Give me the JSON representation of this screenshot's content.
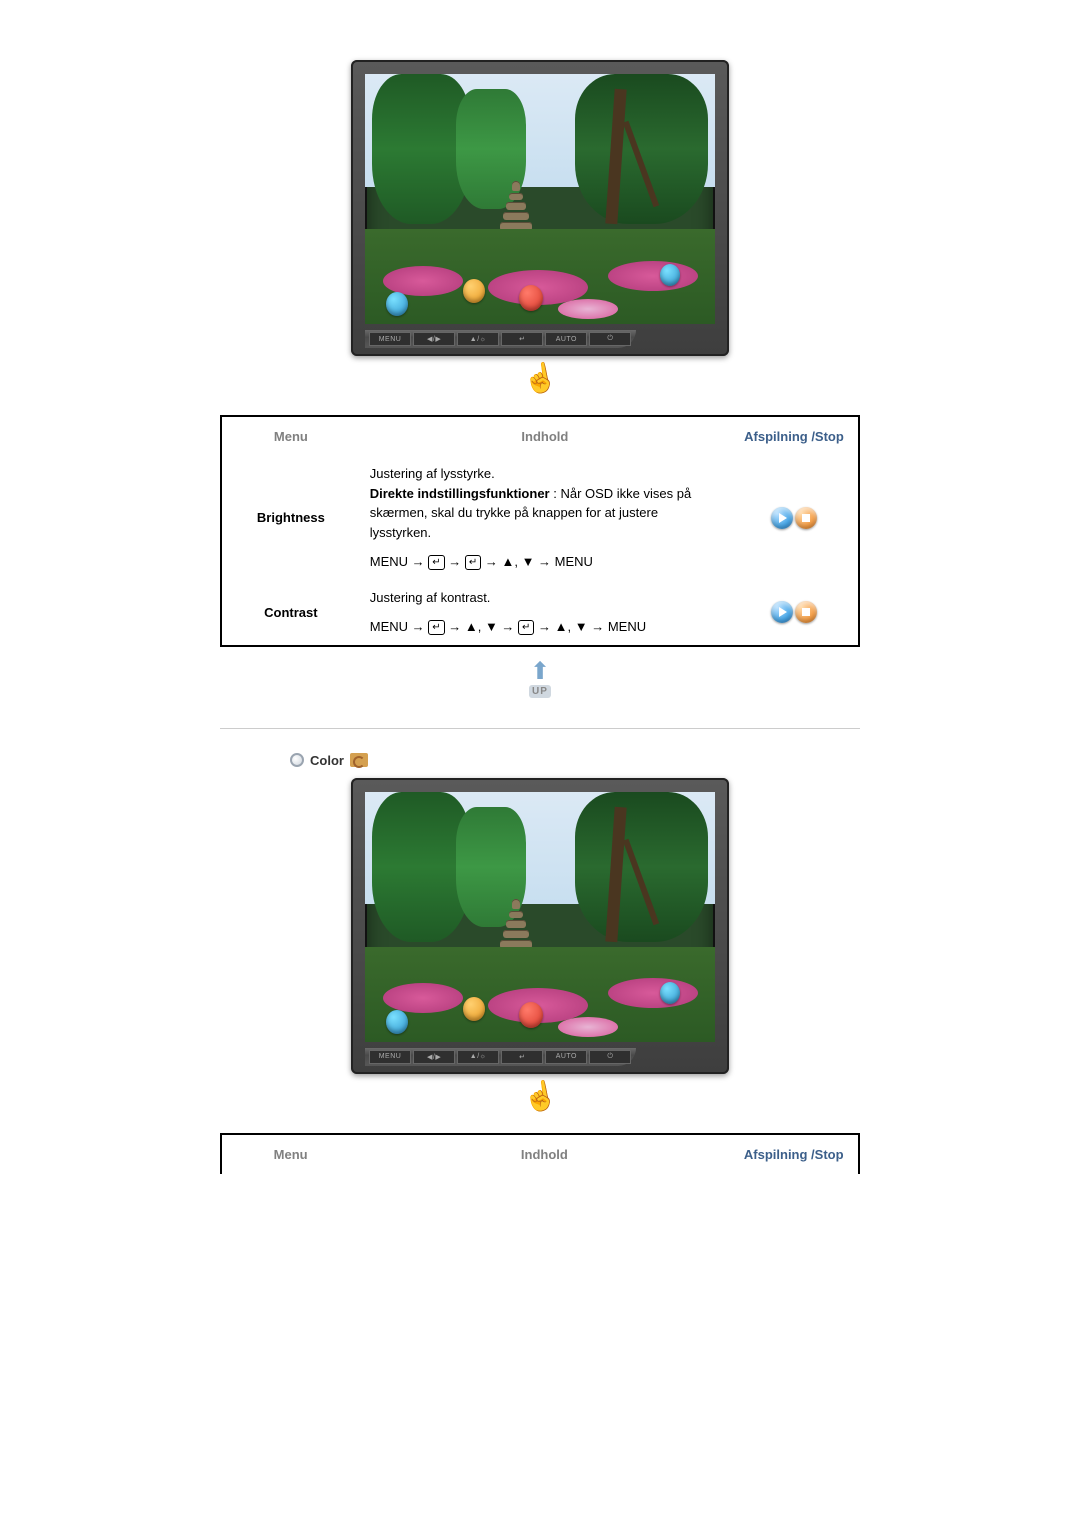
{
  "osd_buttons": [
    "MENU",
    "◀/▶",
    "▲/☼",
    "↵",
    "AUTO",
    "⏻"
  ],
  "table1": {
    "headers": {
      "menu": "Menu",
      "content": "Indhold",
      "play": "Afspilning /Stop"
    },
    "rows": [
      {
        "menu": "Brightness",
        "desc1": "Justering af lysstyrke.",
        "bold": "Direkte indstillingsfunktioner",
        "desc2": " : Når OSD ikke vises på skærmen, skal du trykke på knappen for at justere lysstyrken.",
        "path_prefix": "MENU → ",
        "path_mid1": " → ",
        "path_mid2": " → ▲, ▼ → MENU"
      },
      {
        "menu": "Contrast",
        "desc1": "Justering af kontrast.",
        "path_prefix": "MENU → ",
        "path_mid_a": " → ▲, ▼ → ",
        "path_mid_b": " → ▲, ▼ → MENU"
      }
    ]
  },
  "up_label": "UP",
  "section2_title": "Color",
  "table2": {
    "headers": {
      "menu": "Menu",
      "content": "Indhold",
      "play": "Afspilning /Stop"
    }
  }
}
